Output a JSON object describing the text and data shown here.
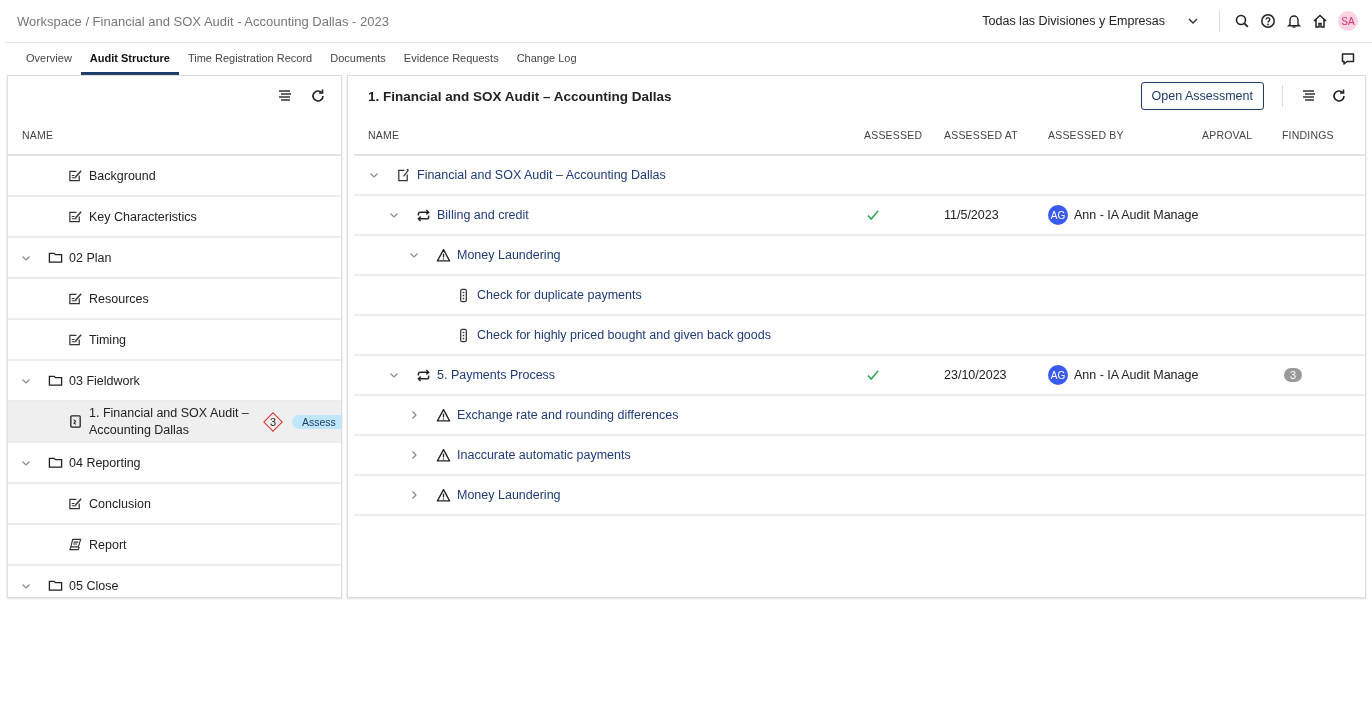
{
  "breadcrumb": "Workspace / Financial and SOX Audit - Accounting Dallas - 2023",
  "division_selector": {
    "value": "Todas las Divisiones y Empresas"
  },
  "user": {
    "initials": "SA"
  },
  "tabs": [
    {
      "label": "Overview",
      "selected": false
    },
    {
      "label": "Audit Structure",
      "selected": true
    },
    {
      "label": "Time Registration Record",
      "selected": false
    },
    {
      "label": "Documents",
      "selected": false
    },
    {
      "label": "Evidence Requests",
      "selected": false
    },
    {
      "label": "Change Log",
      "selected": false
    }
  ],
  "sidebar": {
    "column": "NAME",
    "tree_continued": [
      {
        "label": "Background",
        "kind": "form",
        "selected": false
      },
      {
        "label": "Key Characteristics",
        "kind": "form",
        "selected": false
      }
    ],
    "folders": [
      {
        "label": "02 Plan",
        "expanded": true,
        "children": [
          {
            "label": "Resources",
            "kind": "form",
            "selected": false
          },
          {
            "label": "Timing",
            "kind": "form",
            "selected": false
          }
        ]
      },
      {
        "label": "03 Fieldwork",
        "expanded": true,
        "children": [
          {
            "label": "1. Financial and SOX Audit – Accounting Dallas",
            "kind": "assessment",
            "selected": true,
            "badge": "3",
            "status": "Assess"
          }
        ]
      },
      {
        "label": "04 Reporting",
        "expanded": true,
        "children": [
          {
            "label": "Conclusion",
            "kind": "form",
            "selected": false
          },
          {
            "label": "Report",
            "kind": "report",
            "selected": false
          }
        ]
      },
      {
        "label": "05 Close",
        "expanded": true
      }
    ]
  },
  "table": {
    "title": "1. Financial and SOX Audit – Accounting Dallas",
    "action": "Open Assessment",
    "columns": [
      "NAME",
      "ASSESSED",
      "ASSESSED AT",
      "ASSESSED BY",
      "APROVAL",
      "FINDINGS"
    ],
    "rows": [
      {
        "label": "Financial and SOX Audit – Accounting Dallas",
        "kind": "audit",
        "expanded": true,
        "children": [
          {
            "label": "Billing and credit",
            "kind": "process",
            "expanded": true,
            "assessed": true,
            "assessed_at": "11/5/2023",
            "assessed_by": {
              "initials": "AG",
              "name": "Ann - IA Audit Manage"
            },
            "children": [
              {
                "label": "Money Laundering",
                "kind": "risk",
                "expanded": true,
                "children": [
                  {
                    "label": "Check for duplicate payments",
                    "kind": "control"
                  },
                  {
                    "label": "Check for highly priced bought and given back goods",
                    "kind": "control"
                  }
                ]
              }
            ]
          },
          {
            "label": "5. Payments Process",
            "kind": "process",
            "expanded": true,
            "assessed": true,
            "assessed_at": "23/10/2023",
            "assessed_by": {
              "initials": "AG",
              "name": "Ann - IA Audit Manage"
            },
            "findings": "3",
            "children": [
              {
                "label": "Exchange rate and rounding differences",
                "kind": "risk",
                "expanded": false
              },
              {
                "label": "Inaccurate automatic payments",
                "kind": "risk",
                "expanded": false
              },
              {
                "label": "Money Laundering",
                "kind": "risk",
                "expanded": false
              }
            ]
          }
        ]
      }
    ]
  }
}
